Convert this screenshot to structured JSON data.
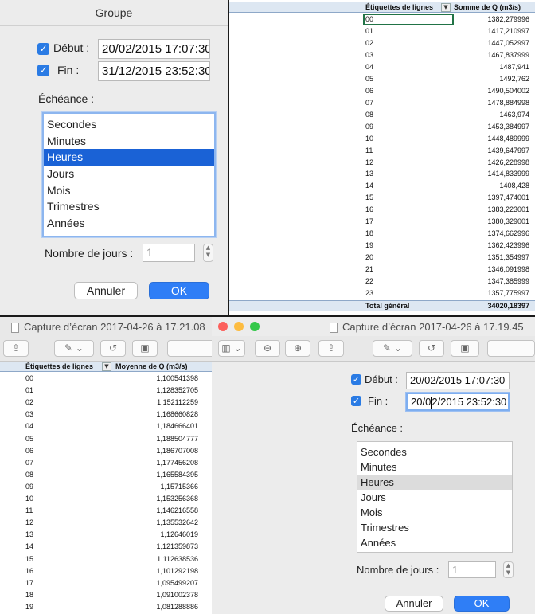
{
  "dialog_top": {
    "title": "Groupe",
    "start_label": "Début :",
    "start_value": "20/02/2015 17:07:30",
    "end_label": "Fin :",
    "end_value": "31/12/2015 23:52:30",
    "interval_label": "Échéance :",
    "intervals": [
      "Secondes",
      "Minutes",
      "Heures",
      "Jours",
      "Mois",
      "Trimestres",
      "Années"
    ],
    "selected_interval": "Heures",
    "days_label": "Nombre de jours :",
    "days_value": "1",
    "cancel": "Annuler",
    "ok": "OK"
  },
  "sheet_top": {
    "col1": "Étiquettes de lignes",
    "col2": "Somme de Q (m3/s)",
    "rows": [
      [
        "00",
        "1382,279996"
      ],
      [
        "01",
        "1417,210997"
      ],
      [
        "02",
        "1447,052997"
      ],
      [
        "03",
        "1467,837999"
      ],
      [
        "04",
        "1487,941"
      ],
      [
        "05",
        "1492,762"
      ],
      [
        "06",
        "1490,504002"
      ],
      [
        "07",
        "1478,884998"
      ],
      [
        "08",
        "1463,974"
      ],
      [
        "09",
        "1453,384997"
      ],
      [
        "10",
        "1448,489999"
      ],
      [
        "11",
        "1439,647997"
      ],
      [
        "12",
        "1426,228998"
      ],
      [
        "13",
        "1414,833999"
      ],
      [
        "14",
        "1408,428"
      ],
      [
        "15",
        "1397,474001"
      ],
      [
        "16",
        "1383,223001"
      ],
      [
        "17",
        "1380,329001"
      ],
      [
        "18",
        "1374,662996"
      ],
      [
        "19",
        "1362,423996"
      ],
      [
        "20",
        "1351,354997"
      ],
      [
        "21",
        "1346,091998"
      ],
      [
        "22",
        "1347,385999"
      ],
      [
        "23",
        "1357,775997"
      ]
    ],
    "total_label": "Total général",
    "total_value": "34020,18397"
  },
  "window_left": {
    "title": "Capture d’écran 2017-04-26 à 17.21.08"
  },
  "sheet_bottom": {
    "col1": "Étiquettes de lignes",
    "col2": "Moyenne de Q (m3/s)",
    "rows": [
      [
        "00",
        "1,100541398"
      ],
      [
        "01",
        "1,128352705"
      ],
      [
        "02",
        "1,152112259"
      ],
      [
        "03",
        "1,168660828"
      ],
      [
        "04",
        "1,184666401"
      ],
      [
        "05",
        "1,188504777"
      ],
      [
        "06",
        "1,186707008"
      ],
      [
        "07",
        "1,177456208"
      ],
      [
        "08",
        "1,165584395"
      ],
      [
        "09",
        "1,15715366"
      ],
      [
        "10",
        "1,153256368"
      ],
      [
        "11",
        "1,146216558"
      ],
      [
        "12",
        "1,135532642"
      ],
      [
        "13",
        "1,12646019"
      ],
      [
        "14",
        "1,121359873"
      ],
      [
        "15",
        "1,112638536"
      ],
      [
        "16",
        "1,101292198"
      ],
      [
        "17",
        "1,095499207"
      ],
      [
        "18",
        "1,091002378"
      ],
      [
        "19",
        "1,081288886"
      ]
    ]
  },
  "window_right": {
    "title": "Capture d’écran 2017-04-26 à 17.19.45"
  },
  "dialog_bottom": {
    "start_label": "Début :",
    "start_value": "20/02/2015 17:07:30",
    "end_label": "Fin :",
    "end_value_before": "20/0",
    "end_value_after": "2/2015 23:52:30",
    "interval_label": "Échéance :",
    "intervals": [
      "Secondes",
      "Minutes",
      "Heures",
      "Jours",
      "Mois",
      "Trimestres",
      "Années"
    ],
    "selected_interval": "Heures",
    "days_label": "Nombre de jours :",
    "days_value": "1",
    "cancel": "Annuler",
    "ok": "OK"
  },
  "colors": {
    "accent": "#2f7ef6",
    "selection": "#1a62d6",
    "selection_inactive": "#dcdcdc",
    "header_fill": "#dde7f2"
  }
}
